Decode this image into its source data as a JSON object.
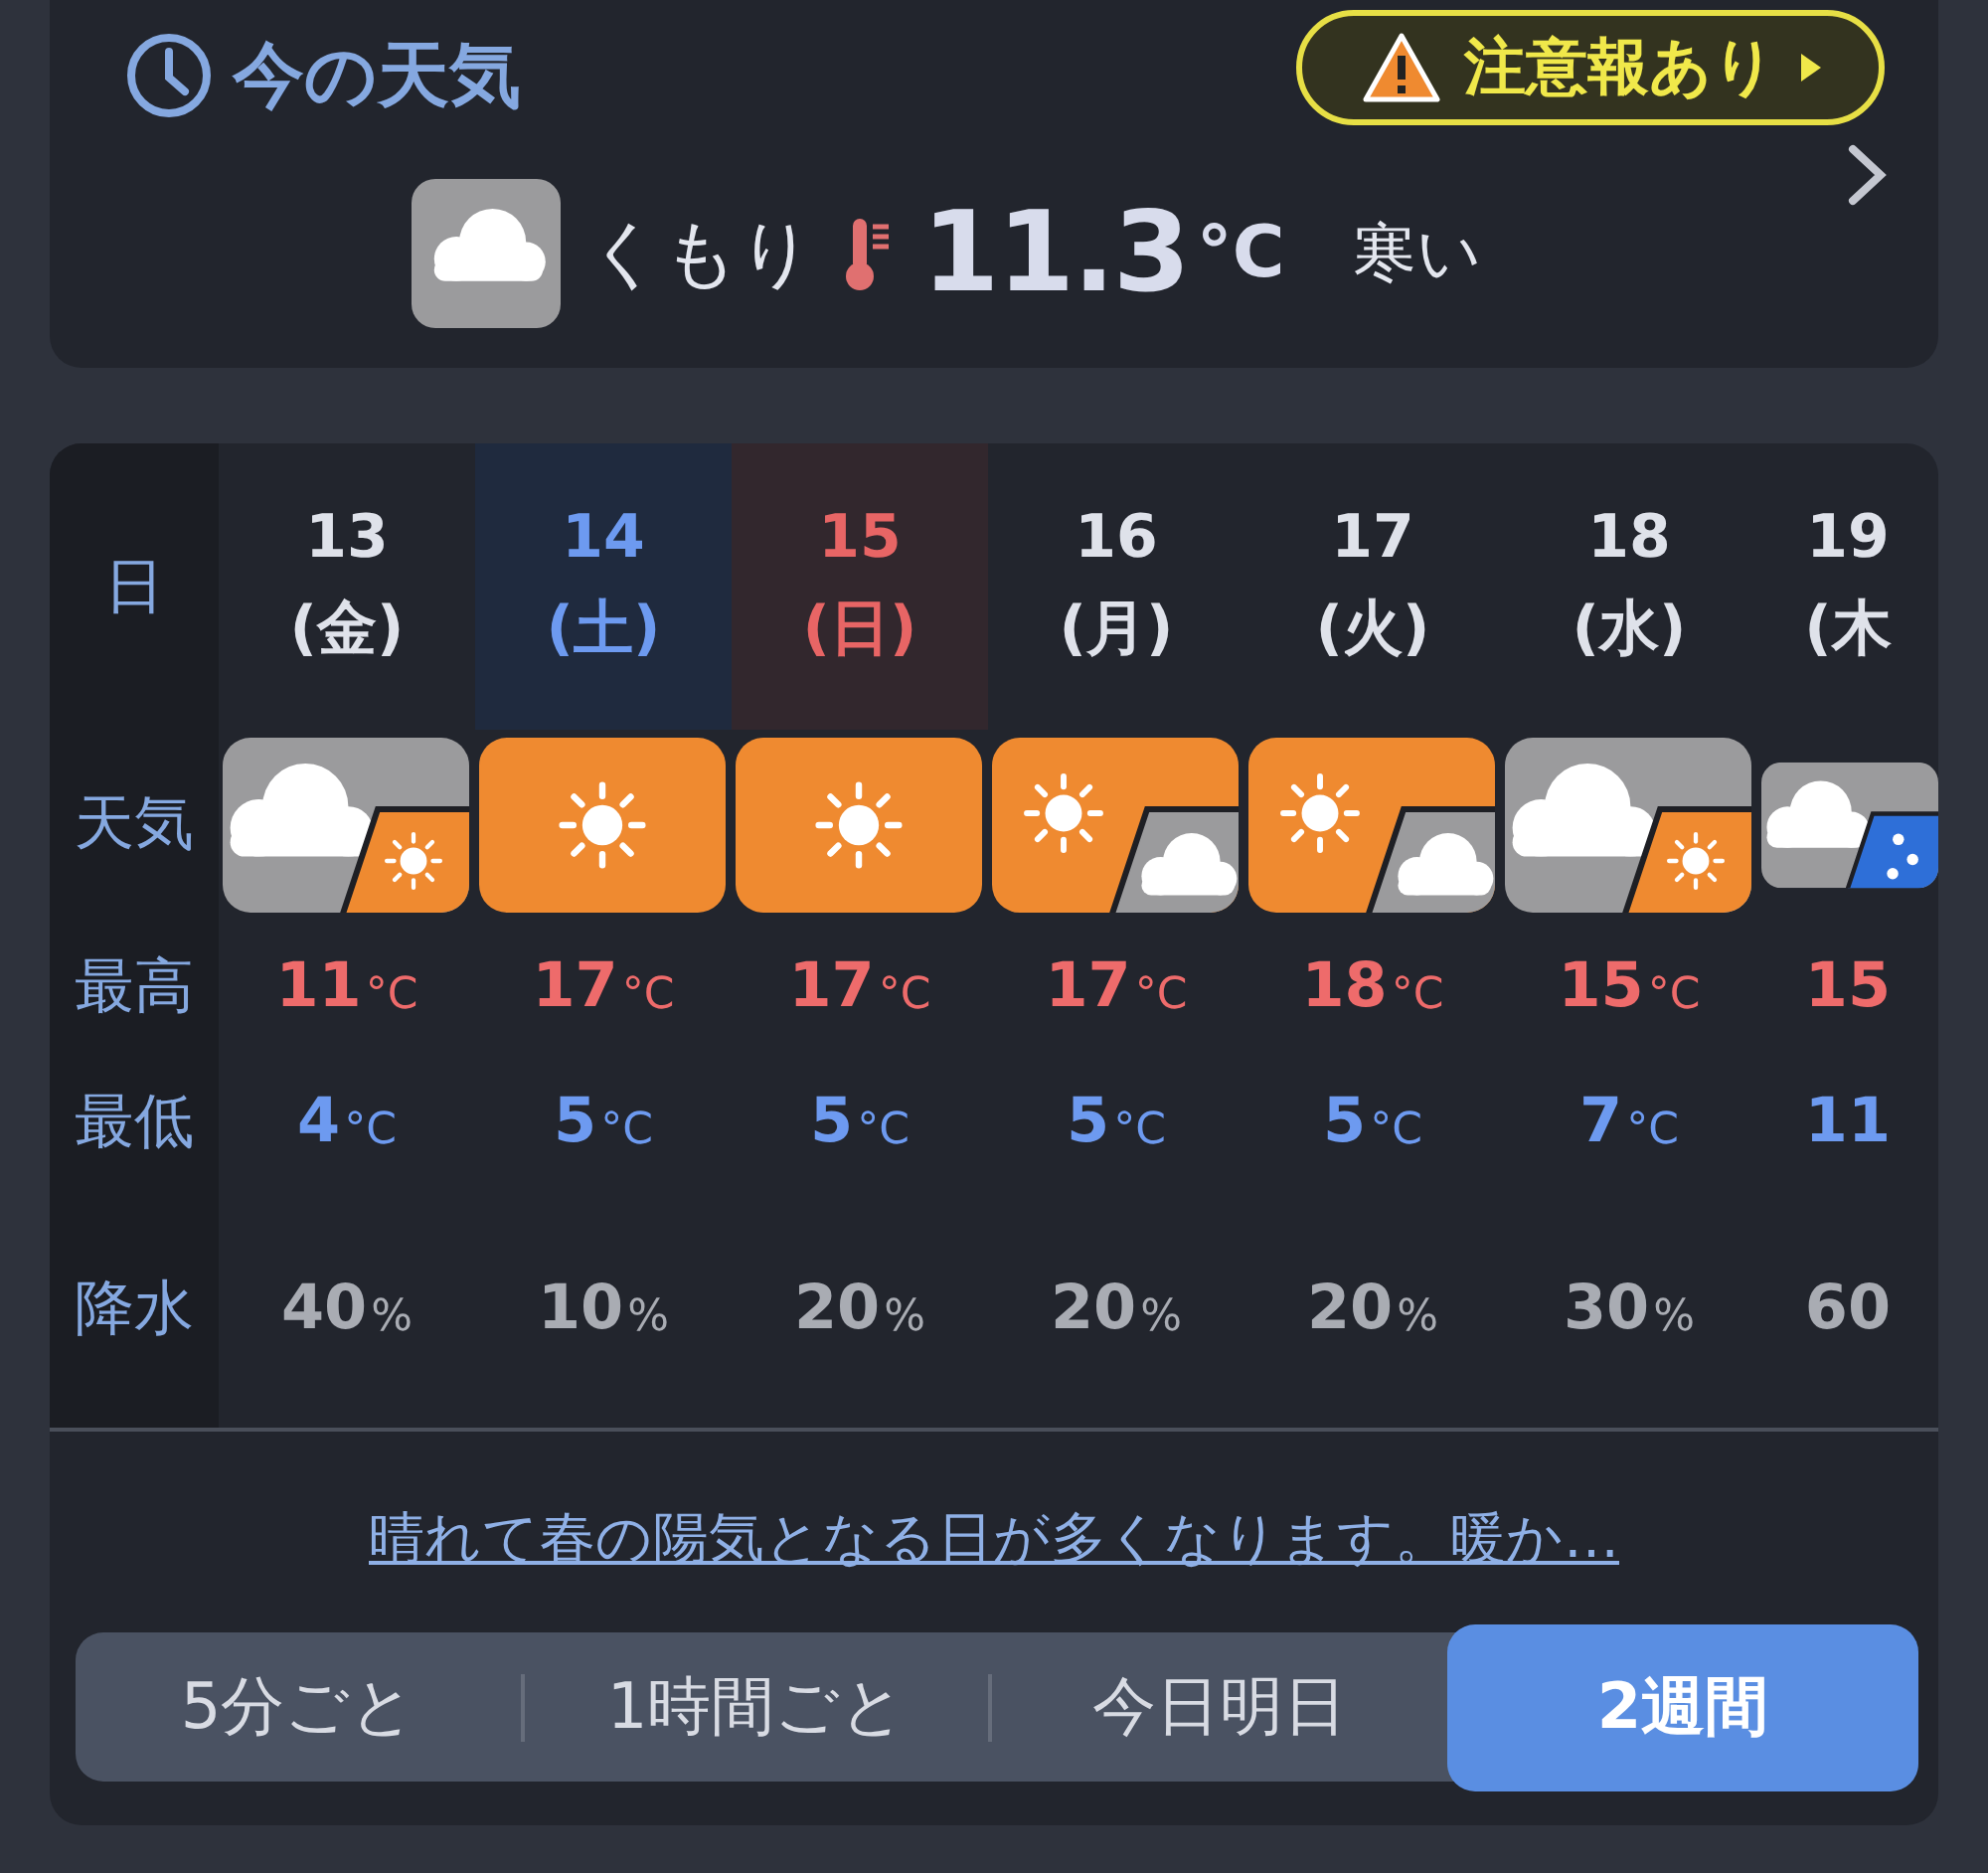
{
  "current": {
    "title": "今の天気",
    "alert": "注意報あり",
    "icon": {
      "kind": "cloud"
    },
    "condition": "くもり",
    "temperature": "11.3",
    "unit": "°C",
    "feel": "寒い"
  },
  "forecast": {
    "labels": {
      "date": "日",
      "weather": "天気",
      "high": "最高",
      "low": "最低",
      "precip": "降水"
    },
    "days": [
      {
        "date": "13",
        "weekday": "(金)",
        "kind": "weekday",
        "icon": {
          "kind": "cloud",
          "then": {
            "kind": "sun"
          }
        },
        "high": "11",
        "high_unit": "°C",
        "low": "4",
        "low_unit": "°C",
        "precip": "40",
        "precip_unit": "%"
      },
      {
        "date": "14",
        "weekday": "(土)",
        "kind": "saturday",
        "icon": {
          "kind": "sun"
        },
        "high": "17",
        "high_unit": "°C",
        "low": "5",
        "low_unit": "°C",
        "precip": "10",
        "precip_unit": "%"
      },
      {
        "date": "15",
        "weekday": "(日)",
        "kind": "sunday",
        "icon": {
          "kind": "sun"
        },
        "high": "17",
        "high_unit": "°C",
        "low": "5",
        "low_unit": "°C",
        "precip": "20",
        "precip_unit": "%"
      },
      {
        "date": "16",
        "weekday": "(月)",
        "kind": "weekday",
        "icon": {
          "kind": "sun",
          "then": {
            "kind": "cloud"
          }
        },
        "high": "17",
        "high_unit": "°C",
        "low": "5",
        "low_unit": "°C",
        "precip": "20",
        "precip_unit": "%"
      },
      {
        "date": "17",
        "weekday": "(火)",
        "kind": "weekday",
        "icon": {
          "kind": "sun",
          "then": {
            "kind": "cloud"
          }
        },
        "high": "18",
        "high_unit": "°C",
        "low": "5",
        "low_unit": "°C",
        "precip": "20",
        "precip_unit": "%"
      },
      {
        "date": "18",
        "weekday": "(水)",
        "kind": "weekday",
        "icon": {
          "kind": "cloud",
          "then": {
            "kind": "sun"
          }
        },
        "high": "15",
        "high_unit": "°C",
        "low": "7",
        "low_unit": "°C",
        "precip": "30",
        "precip_unit": "%"
      },
      {
        "date": "19",
        "weekday": "(木",
        "kind": "weekday",
        "icon": {
          "kind": "cloud",
          "then": {
            "kind": "rain"
          }
        },
        "high": "15",
        "low": "11",
        "precip": "60"
      }
    ],
    "summary": "晴れて春の陽気となる日が多くなります。暖か…",
    "tabs": [
      {
        "label": "5分ごと",
        "selected": false
      },
      {
        "label": "1時間ごと",
        "selected": false
      },
      {
        "label": "今日明日",
        "selected": false
      },
      {
        "label": "2週間",
        "selected": true
      }
    ]
  }
}
